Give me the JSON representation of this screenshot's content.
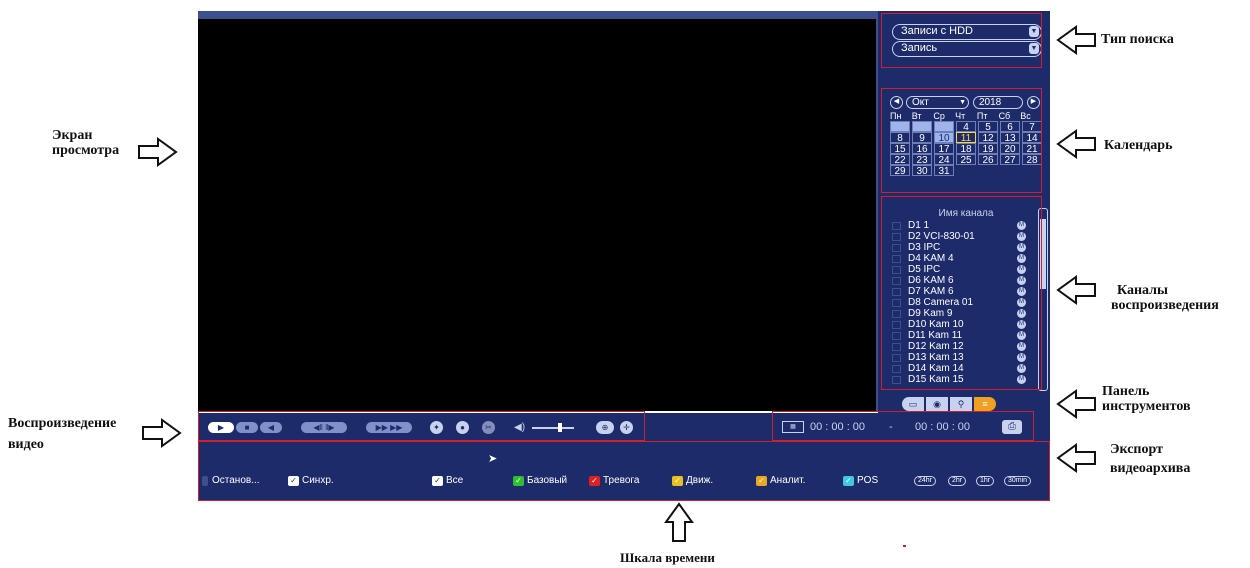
{
  "annotations": {
    "search_type": "Тип поиска",
    "calendar": "Календарь",
    "view_screen_1": "Экран",
    "view_screen_2": "просмотра",
    "channels_1": "Каналы",
    "channels_2": "воспроизведения",
    "toolbar_1": "Панель",
    "toolbar_2": "инструментов",
    "playback_1": "Воспроизведение",
    "playback_2": "видео",
    "export_1": "Экспорт",
    "export_2": "видеоархива",
    "timeline": "Шкала времени"
  },
  "search": {
    "source": "Записи с HDD",
    "type": "Запись"
  },
  "calendar": {
    "month": "Окт",
    "year": "2018",
    "weekdays": [
      "Пн",
      "Вт",
      "Ср",
      "Чт",
      "Пт",
      "Сб",
      "Вс"
    ],
    "days": [
      "",
      "",
      "",
      "4",
      "5",
      "6",
      "7",
      "8",
      "9",
      "10",
      "11",
      "12",
      "13",
      "14",
      "15",
      "16",
      "17",
      "18",
      "19",
      "20",
      "21",
      "22",
      "23",
      "24",
      "25",
      "26",
      "27",
      "28",
      "29",
      "30",
      "31"
    ],
    "highlighted": [
      "1",
      "2",
      "3",
      "10"
    ],
    "today": "11"
  },
  "channels": {
    "header": "Имя канала",
    "items": [
      "D1 1",
      "D2 VCI-830-01",
      "D3 IPC",
      "D4 KAM 4",
      "D5 IPC",
      "D6 KAM 6",
      "D7 KAM 6",
      "D8 Camera 01",
      "D9 Kam 9",
      "D10 Kam 10",
      "D11 Kam 11",
      "D12 Kam 12",
      "D13 Kam 13",
      "D14 Kam 14",
      "D15 Kam 15"
    ]
  },
  "time": {
    "start": "00 : 00 : 00",
    "sep": "-",
    "end": "00 : 00 : 00"
  },
  "legend": {
    "stop": "Останов...",
    "sync": "Синхр.",
    "all": "Все",
    "basic": "Базовый",
    "alarm": "Тревога",
    "motion": "Движ.",
    "analytics": "Аналит.",
    "pos": "POS",
    "colors": {
      "basic": "#2ec02e",
      "alarm": "#e02020",
      "motion": "#e8c020",
      "analytics": "#e8a820",
      "pos": "#40c8e0"
    }
  },
  "zoom": [
    "24hr",
    "2hr",
    "1hr",
    "30min"
  ]
}
